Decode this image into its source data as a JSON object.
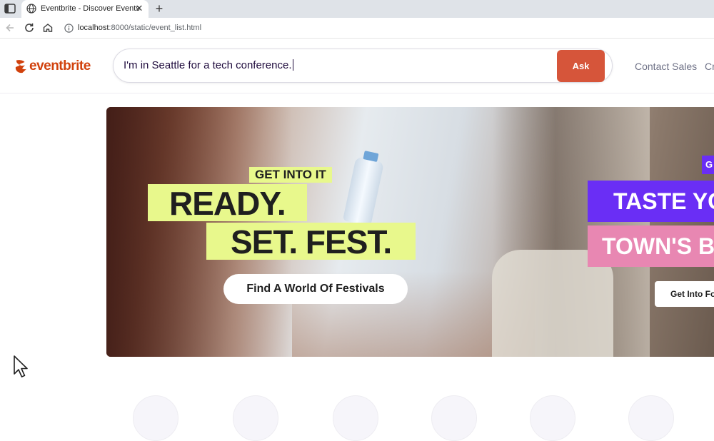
{
  "browser": {
    "tab_title": "Eventbrite - Discover Events",
    "new_tab_label": "+",
    "url_host": "localhost",
    "url_path": ":8000/static/event_list.html"
  },
  "header": {
    "logo_text": "eventbrite",
    "search_value": "I'm in Seattle for a tech conference.",
    "ask_label": "Ask",
    "links": [
      "Contact Sales",
      "Cr"
    ]
  },
  "hero": {
    "tag_small": "GET INTO IT",
    "line1": "READY.",
    "line2": "SET. FEST.",
    "cta": "Find A World Of Festivals",
    "right_chip": "G",
    "right_line1": "TASTE YO",
    "right_line2": "TOWN'S B",
    "right_cta": "Get Into Fo"
  },
  "colors": {
    "brand": "#d1410c",
    "ask": "#d6553a",
    "highlight": "#e8f88c",
    "purple": "#6a2ef5",
    "pink": "#e887b2"
  }
}
